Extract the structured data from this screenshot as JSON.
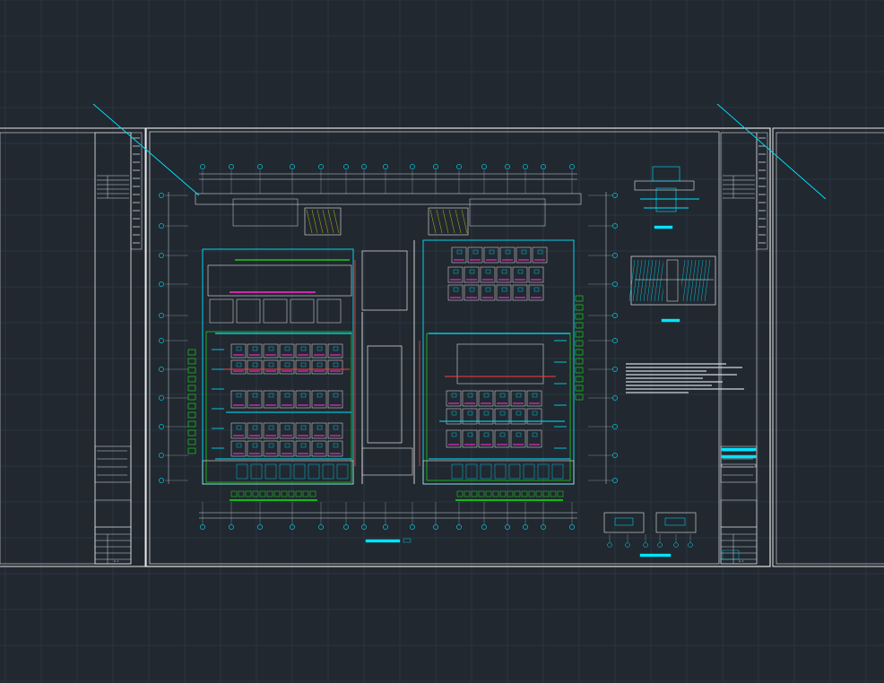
{
  "drawing": {
    "background": "#212830",
    "grid_color": "#2c3540",
    "frame_color": "#e6e6e6",
    "colors": {
      "wall": "#ffffff",
      "cyan": "#00e5ff",
      "green": "#19e619",
      "magenta": "#ff2bd6",
      "red": "#ff3b3b",
      "yellow": "#e6e000",
      "dim": "#9aa4ad"
    },
    "sheet_title_labels": [
      "A-1",
      "A-1"
    ]
  }
}
